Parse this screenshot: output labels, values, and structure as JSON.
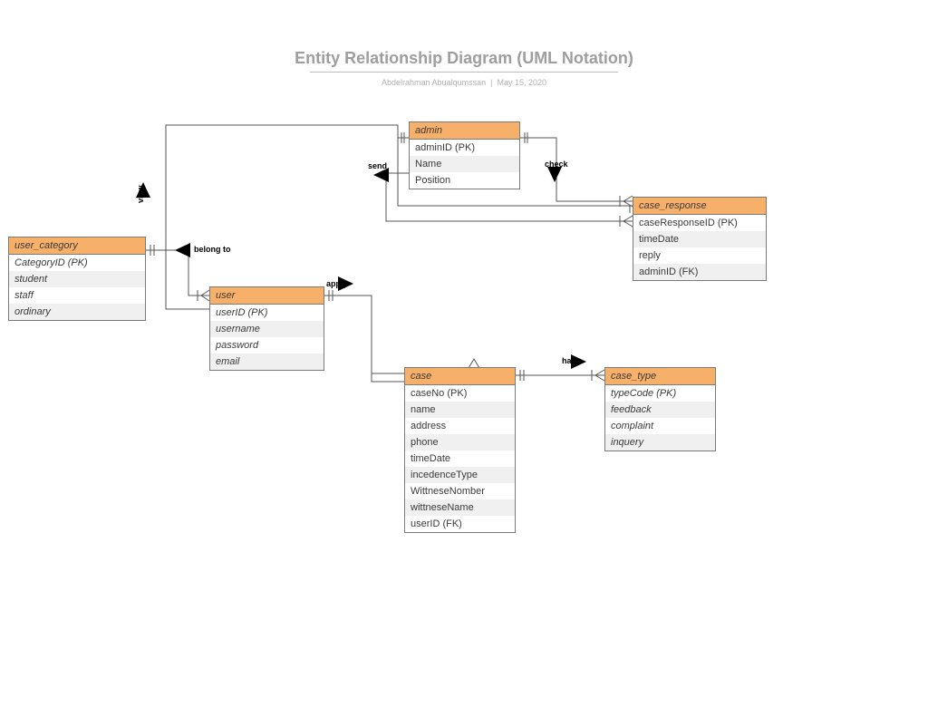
{
  "header": {
    "title": "Entity Relationship Diagram (UML Notation)",
    "author": "Abdelrahman Abualqumssan",
    "divider": "|",
    "date": "May 15, 2020"
  },
  "relations": {
    "view": "view",
    "belong_to": "belong to",
    "send": "send",
    "check": "check",
    "apply": "apply",
    "has": "has"
  },
  "entities": {
    "user_category": {
      "name": "user_category",
      "attrs": [
        "CategoryID (PK)",
        "student",
        "staff",
        "ordinary"
      ]
    },
    "user": {
      "name": "user",
      "attrs": [
        "userID (PK)",
        "username",
        "password",
        "email"
      ]
    },
    "admin": {
      "name": "admin",
      "attrs": [
        "adminID  (PK)",
        "Name",
        "Position"
      ]
    },
    "case": {
      "name": "case",
      "attrs": [
        "caseNo  (PK)",
        "name",
        "address",
        "phone",
        "timeDate",
        "incedenceType",
        "WittneseNomber",
        "wittneseName",
        "userID (FK)"
      ]
    },
    "case_response": {
      "name": "case_response",
      "attrs": [
        "caseResponseID  (PK)",
        "timeDate",
        "reply",
        "adminID (FK)"
      ]
    },
    "case_type": {
      "name": "case_type",
      "attrs": [
        "typeCode (PK)",
        "feedback",
        "complaint",
        "inquery"
      ]
    }
  }
}
